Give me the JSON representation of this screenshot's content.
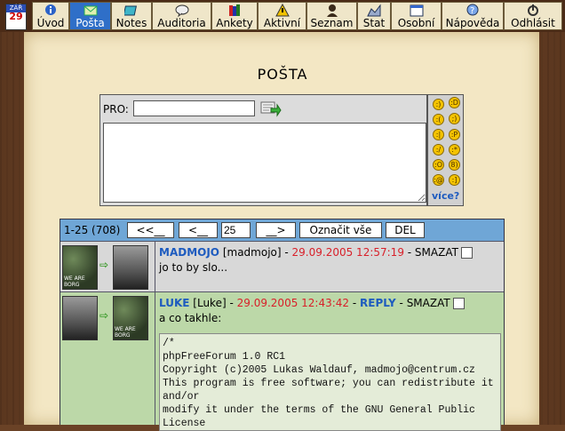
{
  "nav": {
    "calendar": {
      "month": "ZÁŘ",
      "day": "29"
    },
    "tabs": [
      {
        "label": "Úvod",
        "icon": "info-icon"
      },
      {
        "label": "Pošta",
        "icon": "mail-icon",
        "active": true
      },
      {
        "label": "Notes",
        "icon": "notebook-icon"
      },
      {
        "label": "Auditoria",
        "icon": "speech-bubble-icon"
      },
      {
        "label": "Ankety",
        "icon": "books-icon"
      },
      {
        "label": "Aktivní",
        "icon": "warning-icon"
      },
      {
        "label": "Seznam",
        "icon": "person-icon"
      },
      {
        "label": "Stat",
        "icon": "stats-icon"
      },
      {
        "label": "Osobní",
        "icon": "calendar-icon"
      },
      {
        "label": "Nápověda",
        "icon": "help-icon"
      },
      {
        "label": "Odhlásit",
        "icon": "power-icon"
      }
    ]
  },
  "page": {
    "title": "POŠTA"
  },
  "compose": {
    "to_label": "PRO:",
    "to_value": "",
    "message_value": "",
    "more_smileys": "více?"
  },
  "pager": {
    "count_text": "1-25 (708)",
    "first_label": "<<__",
    "prev_label": "<__",
    "page_value": "25",
    "next_label": "__>",
    "mark_all_label": "Označit vše",
    "delete_label": "DEL"
  },
  "messages": [
    {
      "nick": "MADMOJO",
      "login": "[madmojo]",
      "sep1": " - ",
      "datetime": "29.09.2005 12:57:19",
      "sep2": " - ",
      "reply": "",
      "delete": "SMAZAT",
      "body": "jo to by slo...",
      "avatar_caption": "WE ARE BORG"
    },
    {
      "nick": "LUKE",
      "login": "[Luke]",
      "sep1": " - ",
      "datetime": "29.09.2005 12:43:42",
      "sep2": " - ",
      "reply": "REPLY",
      "sep3": " - ",
      "delete": "SMAZAT",
      "body": "a co takhle:",
      "avatar_caption": "WE ARE BORG",
      "code": "/*\nphpFreeForum 1.0 RC1\nCopyright (c)2005 Lukas Waldauf, madmojo@centrum.cz\nThis program is free software; you can redistribute it\nand/or\nmodify it under the terms of the GNU General Public\nLicense"
    }
  ]
}
